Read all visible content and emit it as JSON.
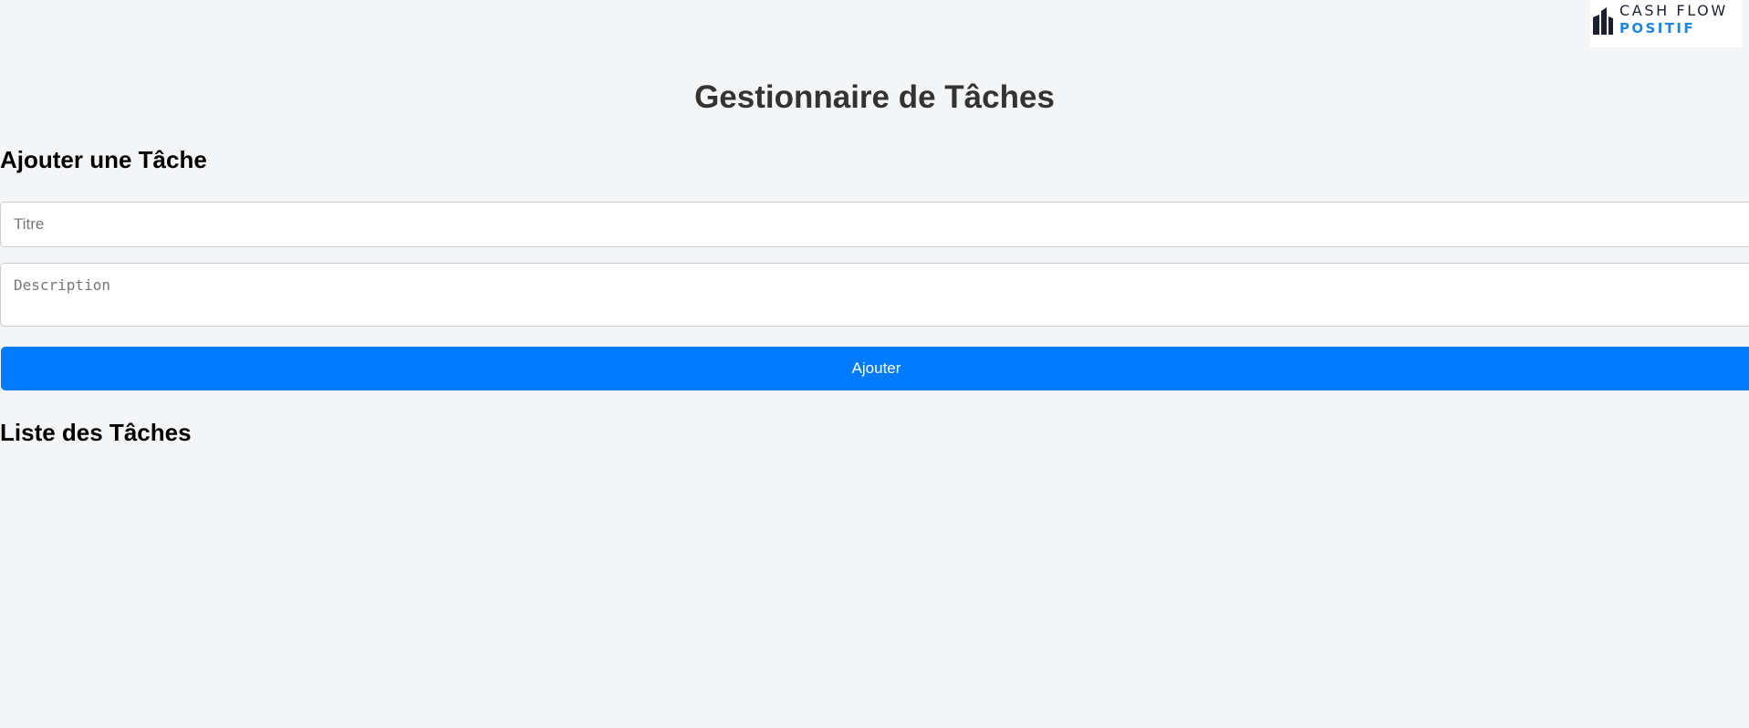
{
  "logo": {
    "line1": "CASH FLOW",
    "line2": "POSITIF",
    "colors": {
      "mark": "#1c2131",
      "line1": "#1c2131",
      "line2": "#1f86e0"
    }
  },
  "page_title": "Gestionnaire de Tâches",
  "add_section": {
    "heading": "Ajouter une Tâche",
    "title_placeholder": "Titre",
    "description_placeholder": "Description",
    "submit_label": "Ajouter"
  },
  "list_section": {
    "heading": "Liste des Tâches",
    "tasks": []
  },
  "colors": {
    "background": "#f4f5f7",
    "accent": "#007bff",
    "title_text": "#333333"
  }
}
